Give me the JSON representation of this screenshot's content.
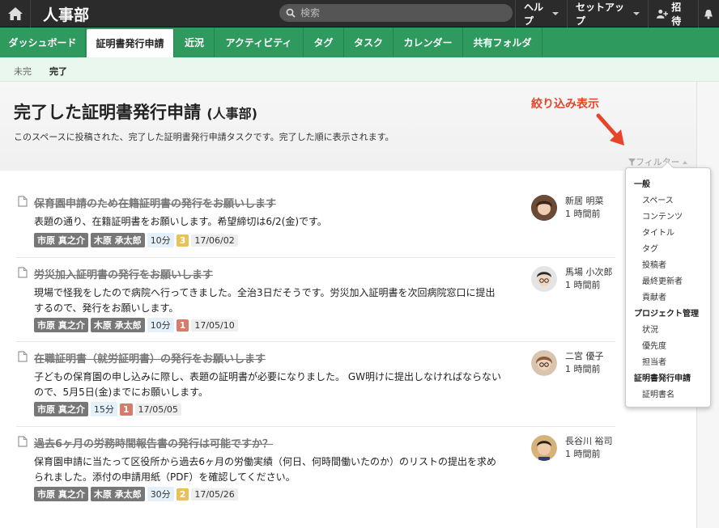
{
  "topbar": {
    "app_name": "人事部",
    "search_placeholder": "検索",
    "help": "ヘルプ",
    "setup": "セットアップ",
    "invite": "招待"
  },
  "tabs": [
    "ダッシュボード",
    "証明書発行申請",
    "近況",
    "アクティビティ",
    "タグ",
    "タスク",
    "カレンダー",
    "共有フォルダ"
  ],
  "active_tab": "証明書発行申請",
  "subnav": {
    "incomplete": "未完",
    "complete": "完了"
  },
  "header": {
    "title": "完了した証明書発行申請",
    "title_suffix": "(人事部)",
    "description": "このスペースに投稿された、完了した証明書発行申請タスクです。完了した順に表示されます。",
    "annotation": "絞り込み表示",
    "filter_label": "フィルター"
  },
  "items": [
    {
      "title": "保育園申請のため在籍証明書の発行をお願いします",
      "body": "表題の通り、在籍証明書をお願いします。希望締切は6/2(金)です。",
      "users": [
        "市原 真之介",
        "木原 承太郎"
      ],
      "time": "10分",
      "count": "3",
      "count_color": "#e8c15a",
      "date": "17/06/02",
      "person": "新居 明菜",
      "ago": "1 時間前"
    },
    {
      "title": "労災加入証明書の発行をお願いします",
      "body": "現場で怪我をしたので病院へ行ってきました。全治3日だそうです。労災加入証明書を次回病院窓口に提出するので、発行をお願いします。",
      "users": [
        "市原 真之介",
        "木原 承太郎"
      ],
      "time": "10分",
      "count": "1",
      "count_color": "#d77b6c",
      "date": "17/05/10",
      "person": "馬場 小次郎",
      "ago": "1 時間前"
    },
    {
      "title": "在職証明書（就労証明書）の発行をお願いします",
      "body": "子どもの保育園の申し込みに際し、表題の証明書が必要になりました。 GW明けに提出しなければならないので、5月5日(金)までにお願いします。",
      "users": [
        "市原 真之介"
      ],
      "time": "15分",
      "count": "1",
      "count_color": "#d77b6c",
      "date": "17/05/05",
      "person": "二宮 優子",
      "ago": "1 時間前"
    },
    {
      "title": "過去6ヶ月の労務時間報告書の発行は可能ですか？",
      "body": "保育園申請に当たって区役所から過去6ヶ月の労働実績（何日、何時間働いたのか）のリストの提出を求められました。添付の申請用紙（PDF）を確認してください。",
      "users": [
        "市原 真之介",
        "木原 承太郎"
      ],
      "time": "30分",
      "count": "2",
      "count_color": "#e8c15a",
      "date": "17/05/26",
      "person": "長谷川 裕司",
      "ago": "1 時間前"
    }
  ],
  "filter_menu": {
    "sections": [
      {
        "heading": "一般",
        "options": [
          "スペース",
          "コンテンツ",
          "タイトル",
          "タグ",
          "投稿者",
          "最終更新者",
          "貢献者"
        ]
      },
      {
        "heading": "プロジェクト管理",
        "options": [
          "状況",
          "優先度",
          "担当者"
        ]
      },
      {
        "heading": "証明書発行申請",
        "options": [
          "証明書名"
        ]
      }
    ]
  },
  "colors": {
    "tab_green": "#2f9a5e",
    "annotation_red": "#e8442a",
    "topbar": "#2b2b2b"
  }
}
